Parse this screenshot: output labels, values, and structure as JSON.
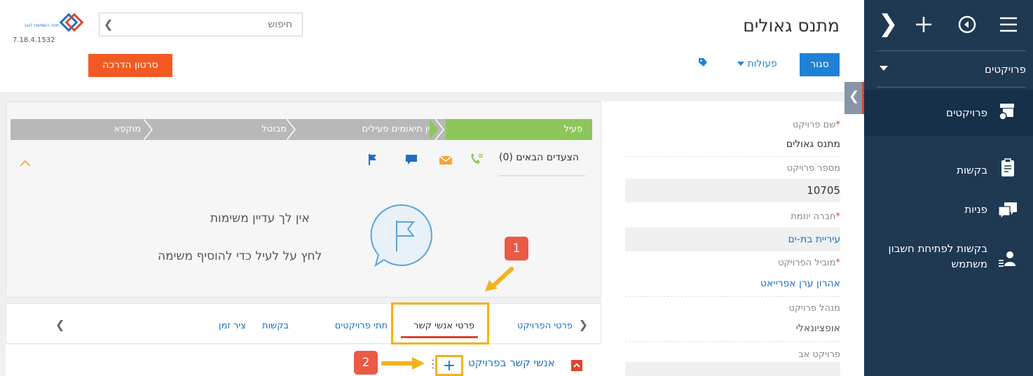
{
  "sidebar": {
    "section_label": "פרויקטים",
    "items": [
      {
        "label": "פרויקטים",
        "icon": "projects-icon"
      },
      {
        "label": "בקשות",
        "icon": "clipboard-icon"
      },
      {
        "label": "פניות",
        "icon": "chat-icon"
      },
      {
        "label": "בקשות לפתיחת חשבון משתמש",
        "icon": "user-list-icon"
      }
    ]
  },
  "header": {
    "title": "מתנס גאולים",
    "status_button": "סגור",
    "actions_label": "פעולות",
    "search_placeholder": "חיפוש",
    "version": "7.18.4.1532",
    "tutorial_button": "סרטון הדרכה",
    "logo_text": "מטה השמשות לנגב"
  },
  "fields": [
    {
      "label": "שם פרויקט",
      "required": "*",
      "value": "מתנס גאולים"
    },
    {
      "label": "מספר פרויקט",
      "required": "",
      "value": "10705"
    },
    {
      "label": "חברה יוזמת",
      "required": "*",
      "value": "עיריית בת-ים"
    },
    {
      "label": "מוביל הפרויקט",
      "required": "*",
      "value": "אהרון ערן אפרייאט"
    },
    {
      "label": "מנהל פרויקט",
      "required": "",
      "value": "אופציונאלי"
    },
    {
      "label": "פרויקט אב",
      "required": "",
      "value": ""
    }
  ],
  "stages": [
    "פעיל",
    "אין תיאומים פעילים",
    "מבוטל",
    "מוקפא"
  ],
  "activities": {
    "next_steps_label": "הצעדים הבאים (0)",
    "empty_title": "אין לך עדיין משימות",
    "empty_hint": "לחץ על  לעיל כדי להוסיף משימה"
  },
  "tabs": [
    "פרטי הפרויקט",
    "פרטי אנשי קשר",
    "תתי פרויקטים",
    "בקשות",
    "ציר זמן"
  ],
  "contacts_section": {
    "title": "אנשי קשר בפרויקט",
    "add_symbol": "+"
  },
  "annotations": [
    "1",
    "2"
  ],
  "colors": {
    "sidebar": "#1f3953",
    "accent": "#1e82d7",
    "active_stage": "#8dc65a",
    "inactive_stage": "#b8b8b8",
    "tutorial": "#f35a23",
    "highlight": "#f3b21b",
    "badge": "#ea5a44"
  }
}
